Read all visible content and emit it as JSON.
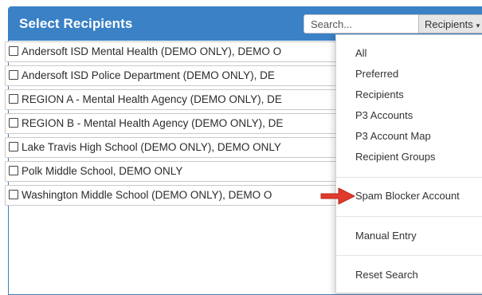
{
  "panel": {
    "title": "Select Recipients",
    "search": {
      "placeholder": "Search...",
      "value": ""
    },
    "dropdown_label": "Recipients"
  },
  "rows": [
    "Andersoft ISD Mental Health (DEMO ONLY), DEMO O",
    "Andersoft ISD Police Department (DEMO ONLY), DE",
    "REGION A - Mental Health Agency (DEMO ONLY), DE",
    "REGION B - Mental Health Agency (DEMO ONLY), DE",
    "Lake Travis High School (DEMO ONLY), DEMO ONLY",
    "Polk Middle School, DEMO ONLY",
    "Washington Middle School (DEMO ONLY), DEMO O"
  ],
  "menu": {
    "items": [
      "All",
      "Preferred",
      "Recipients",
      "P3 Accounts",
      "P3 Account Map",
      "Recipient Groups",
      "Spam Blocker Account",
      "Manual Entry",
      "Reset Search"
    ]
  },
  "colors": {
    "header": "#3a81c6",
    "arrow": "#e03a2c"
  },
  "icons": {
    "dropdown_caret": "chevron-down-icon",
    "row_checkbox": "checkbox-icon",
    "pointer_arrow": "red-arrow-icon"
  }
}
